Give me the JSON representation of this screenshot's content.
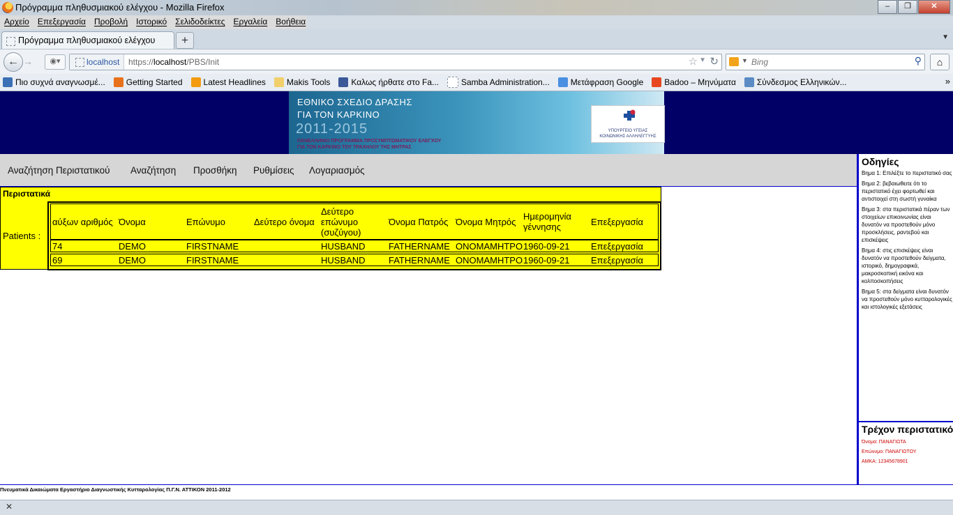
{
  "window": {
    "title": "Πρόγραμμα πληθυσμιακού ελέγχου - Mozilla Firefox",
    "controls": {
      "minimize": "–",
      "maximize": "❐",
      "close": "✕"
    }
  },
  "menubar": [
    "Αρχείο",
    "Επεξεργασία",
    "Προβολή",
    "Ιστορικό",
    "Σελιδοδείκτες",
    "Εργαλεία",
    "Βοήθεια"
  ],
  "tabs": [
    {
      "title": "Πρόγραμμα πληθυσμιακού ελέγχου",
      "active": true
    }
  ],
  "nav": {
    "site_label": "localhost",
    "url_prefix": "https://",
    "url_host": "localhost",
    "url_path": "/PBS/Init",
    "search_placeholder": "Bing"
  },
  "bookmarks": [
    {
      "label": "Πιο συχνά αναγνωσμέ...",
      "icon": "frequent-icon",
      "color": "#3b6fb6"
    },
    {
      "label": "Getting Started",
      "icon": "firefox-icon",
      "color": "#e8721c"
    },
    {
      "label": "Latest Headlines",
      "icon": "rss-icon",
      "color": "#f39c12"
    },
    {
      "label": "Makis Tools",
      "icon": "folder-icon",
      "color": "#f1d06b"
    },
    {
      "label": "Καλως ήρθατε στο Fa...",
      "icon": "facebook-icon",
      "color": "#3b5998"
    },
    {
      "label": "Samba Administration...",
      "icon": "page-icon",
      "color": "#ffffff"
    },
    {
      "label": "Μετάφραση Google",
      "icon": "translate-icon",
      "color": "#4a90e2"
    },
    {
      "label": "Badoo – Μηνύματα",
      "icon": "badoo-icon",
      "color": "#e8461f"
    },
    {
      "label": "Σύνδεσμος Ελληνικών...",
      "icon": "site-icon",
      "color": "#5a8bc4"
    }
  ],
  "header": {
    "banner_line1": "ΕΘΝΙΚΟ ΣΧΕΔΙΟ ΔΡΑΣΗΣ",
    "banner_line2": "ΓΙΑ ΤΟΝ ΚΑΡΚΙΝΟ",
    "banner_years": "2011-2015",
    "banner_sub1": "ΠΑΝΕΛΛΗΝΙΟ ΠΡΟΓΡΑΜΜΑ ΠΡΟΣΥΜΠΤΩΜΑΤΙΚΟΥ ΕΛΕΓΧΟΥ",
    "banner_sub2": "ΓΙΑ ΤΟΝ ΚΑΡΚΙΝΟ ΤΟΥ ΤΡΑΧΗΛΟΥ ΤΗΣ ΜΗΤΡΑΣ",
    "ministry_line1": "ΥΠΟΥΡΓΕΙΟ ΥΓΕΙΑΣ",
    "ministry_line2": "ΚΟΙΝΩΝΙΚΗΣ ΑΛΛΗΛΕΓΓΥΗΣ"
  },
  "appnav": [
    "Αναζήτηση Περιστατικού",
    "Αναζήτηση",
    "Προσθήκη",
    "Ρυθμίσεις",
    "Λογαριασμός"
  ],
  "patients": {
    "title": "Περιστατικά",
    "label": "Patients :",
    "columns": [
      "αύξων αριθμός",
      "Όνομα",
      "Επώνυμο",
      "Δεύτερο όνομα",
      "Δεύτερο επώνυμο (συζύγου)",
      "Όνομα Πατρός",
      "Όνομα Μητρός",
      "Ημερομηνία γέννησης",
      "Επεξεργασία"
    ],
    "rows": [
      [
        "74",
        "DEMO",
        "FIRSTNAME",
        "",
        "HUSBAND",
        "FATHERNAME",
        "ΟΝΟΜΑΜΗΤΡΟΣ",
        "1960-09-21",
        "Επεξεργασία"
      ],
      [
        "69",
        "DEMO",
        "FIRSTNAME",
        "",
        "HUSBAND",
        "FATHERNAME",
        "ΟΝΟΜΑΜΗΤΡΟΣ",
        "1960-09-21",
        "Επεξεργασία"
      ]
    ]
  },
  "sidebar": {
    "title": "Οδηγίες",
    "steps": [
      "Βημα 1: Επιλέξτε το περιστατικό σας",
      "Βημα 2: βεβαιωθειτε ότι το περιστατικό έχει φορτωθεί και αντιστοιχεί στη σωστή γυναίκα",
      "Βημα 3: στα περιστατικά πέραν των στοιχείων επικοινωνίας είναι δυνατόν να προστεθούν μόνο προσκλήσεις, ραντεβού και επισκέψεις",
      "Βημα 4: στις επισκέψεις είναι δυνατόν να προστεθούν δείγματα, ιστορικό, δημογραφικά, μακροσκοπική εικόνα και κολποσκοπήσεις",
      "Βημα 5: στα δείγματα είναι δυνατόν να προστεθούν μόνο κυτταρολογικές και ιστολογικές εξετάσεις"
    ],
    "current_title": "Τρέχον περιστατικό",
    "current_lines": [
      "Όνομα: ΠΑΝΑΓΙΩΤΑ",
      "Επώνυμο: ΠΑΝΑΓΙΩΤΟΥ",
      "ΑΜΚΑ: 12345678901"
    ]
  },
  "footer": "Πνευματικά Δικαιώματα Εργαστήριο Διαγνωστικής Κυτταρολογίας Π.Γ.Ν. ΑΤΤΙΚΟΝ 2011-2012",
  "colors": {
    "header_bg": "#000066",
    "table_bg": "#ffff00",
    "accent_line": "#0000cc",
    "current_text": "#cc0000"
  }
}
